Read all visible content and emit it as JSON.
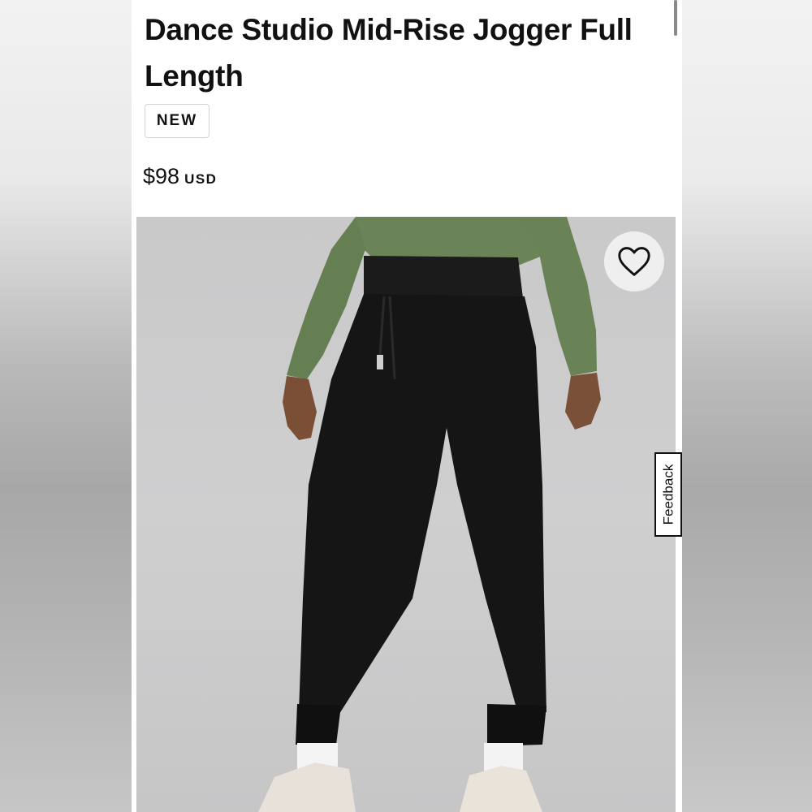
{
  "product": {
    "title": "Dance Studio Mid-Rise Jogger Full Length",
    "badge": "NEW",
    "price": "$98",
    "currency": "USD"
  },
  "image": {
    "alt": "Black jogger pants worn with green long-sleeve top",
    "background_color": "#cbcbcc"
  },
  "actions": {
    "wishlist_icon": "heart-outline-icon"
  },
  "feedback": {
    "label": "Feedback"
  },
  "colors": {
    "text": "#111111",
    "top_green": "#6b8457",
    "pants_black": "#151515"
  }
}
